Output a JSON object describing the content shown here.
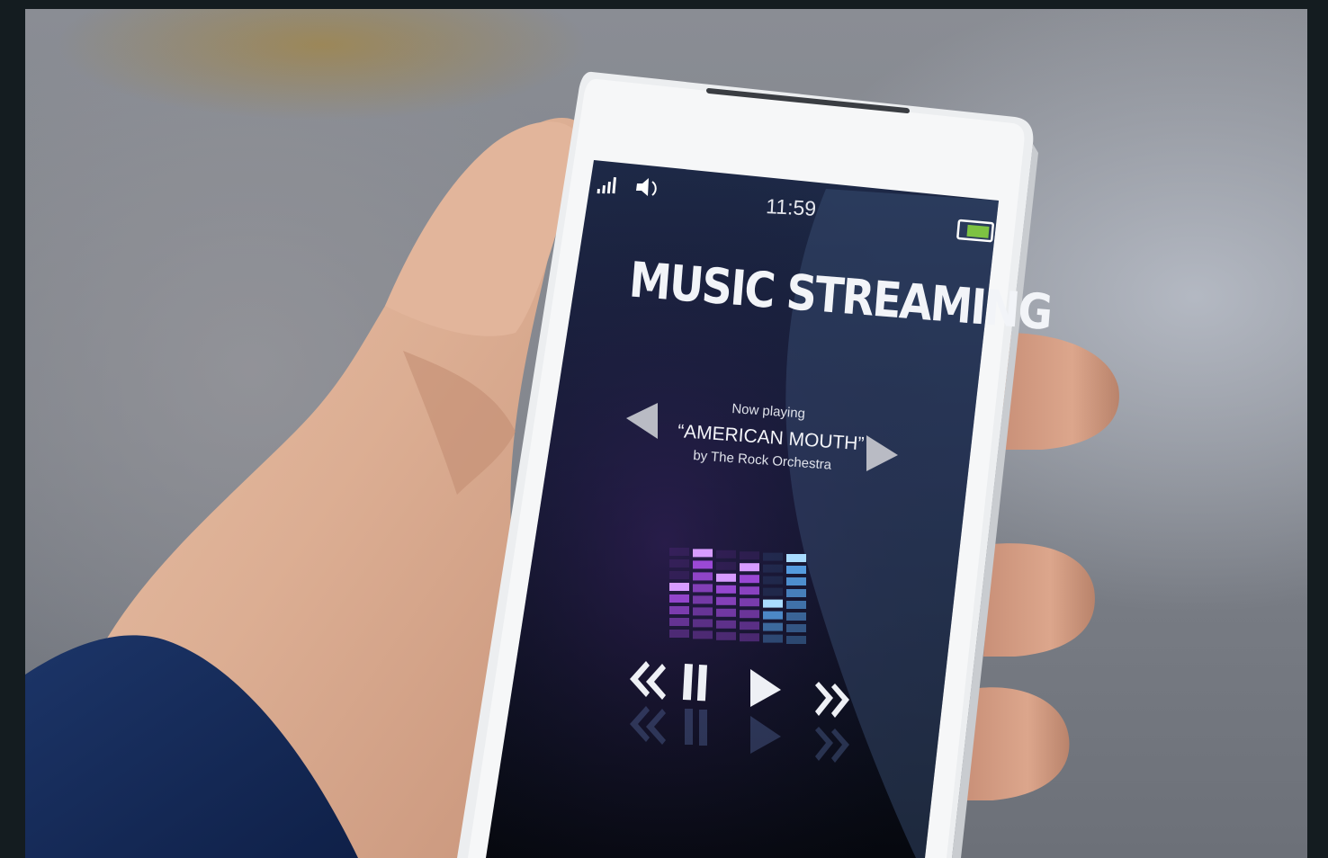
{
  "phone": {
    "status_bar": {
      "time": "11:59",
      "signal_icon": "signal-bars-icon",
      "volume_icon": "speaker-icon",
      "battery_icon": "battery-icon",
      "battery_level": 0.75,
      "battery_color": "#7dc242"
    },
    "app": {
      "title": "MUSIC STREAMING",
      "now_playing_label": "Now playing",
      "song_title": "“AMERICAN MOUTH”",
      "artist_line": "by The Rock Orchestra",
      "controls": {
        "previous_track_icon": "triangle-left-icon",
        "next_track_icon": "triangle-right-icon",
        "rewind_icon": "rewind-icon",
        "pause_icon": "pause-icon",
        "play_icon": "play-icon",
        "fast_forward_icon": "fast-forward-icon"
      },
      "equalizer_levels": [
        3,
        6,
        4,
        5,
        2,
        6
      ]
    },
    "colors": {
      "screen_top": "#1b2744",
      "screen_bottom": "#070910",
      "eq_purple": "#a84ee6",
      "eq_blue": "#5aa8f0"
    }
  }
}
